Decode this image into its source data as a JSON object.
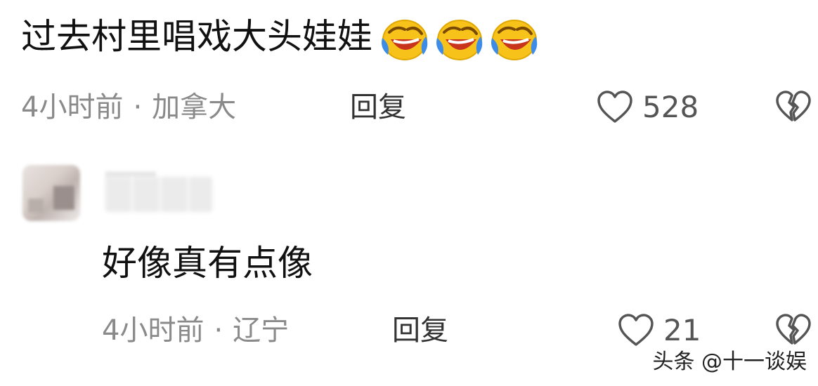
{
  "comments": [
    {
      "text": "过去村里唱戏大头娃娃",
      "emojis": [
        "laugh-cry-emoji",
        "laugh-cry-emoji",
        "laugh-cry-emoji"
      ],
      "time": "4小时前",
      "separator": "·",
      "location": "加拿大",
      "reply_label": "回复",
      "likes": "528"
    },
    {
      "text": "好像真有点像",
      "time": "4小时前",
      "separator": "·",
      "location": "辽宁",
      "reply_label": "回复",
      "likes": "21"
    }
  ],
  "watermark": "头条 @十一谈娱",
  "icons": {
    "like": "heart-outline-icon",
    "dislike": "broken-heart-icon"
  },
  "colors": {
    "text": "#111111",
    "meta": "#8a8a8a",
    "emoji_face": "#f7c21a",
    "emoji_tear": "#3d8ce8"
  }
}
